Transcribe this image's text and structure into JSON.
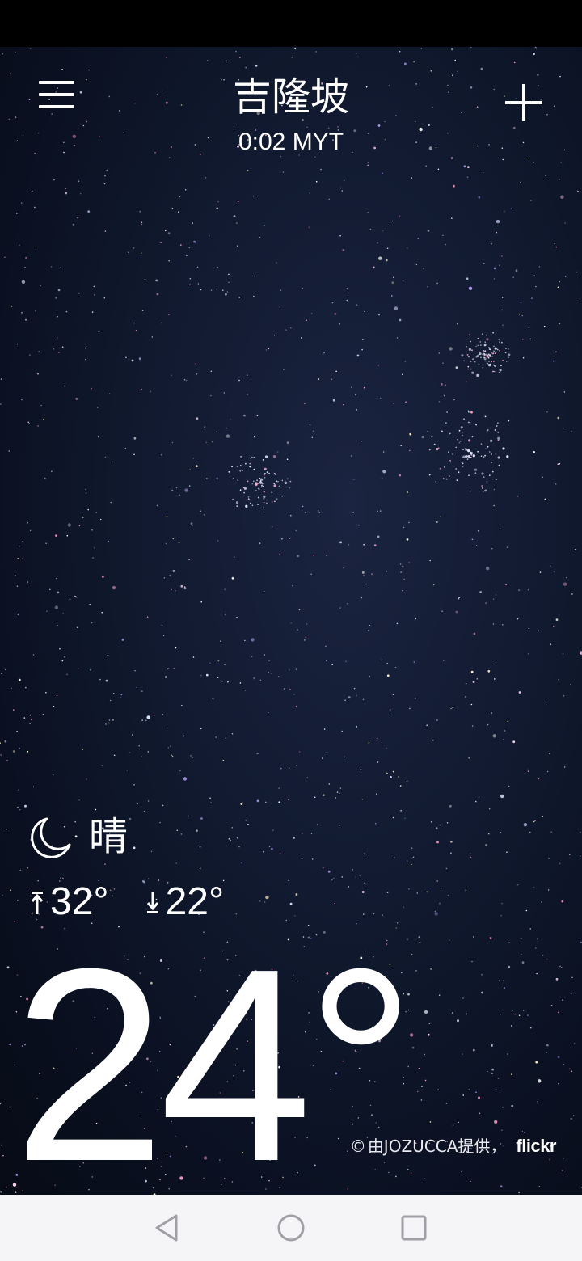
{
  "header": {
    "city": "吉隆坡",
    "local_time": "0:02 MYT",
    "menu_icon": "hamburger-menu-icon",
    "add_icon": "plus-icon"
  },
  "current": {
    "condition_icon": "crescent-moon-icon",
    "condition": "晴",
    "high": "32°",
    "low": "22°",
    "temperature": "24°"
  },
  "credit": {
    "icon": "copyright-icon",
    "symbol": "©",
    "text": "由JOZUCCA提供，",
    "brand": "flickr"
  },
  "nav": {
    "back_icon": "back-triangle-icon",
    "home_icon": "home-circle-icon",
    "recents_icon": "recents-square-icon"
  },
  "colors": {
    "status_bar": "#000000",
    "sky_background": "#0d1424",
    "text": "#ffffff",
    "nav_bar": "#f5f5f7",
    "nav_icons": "#a0a0a6"
  }
}
